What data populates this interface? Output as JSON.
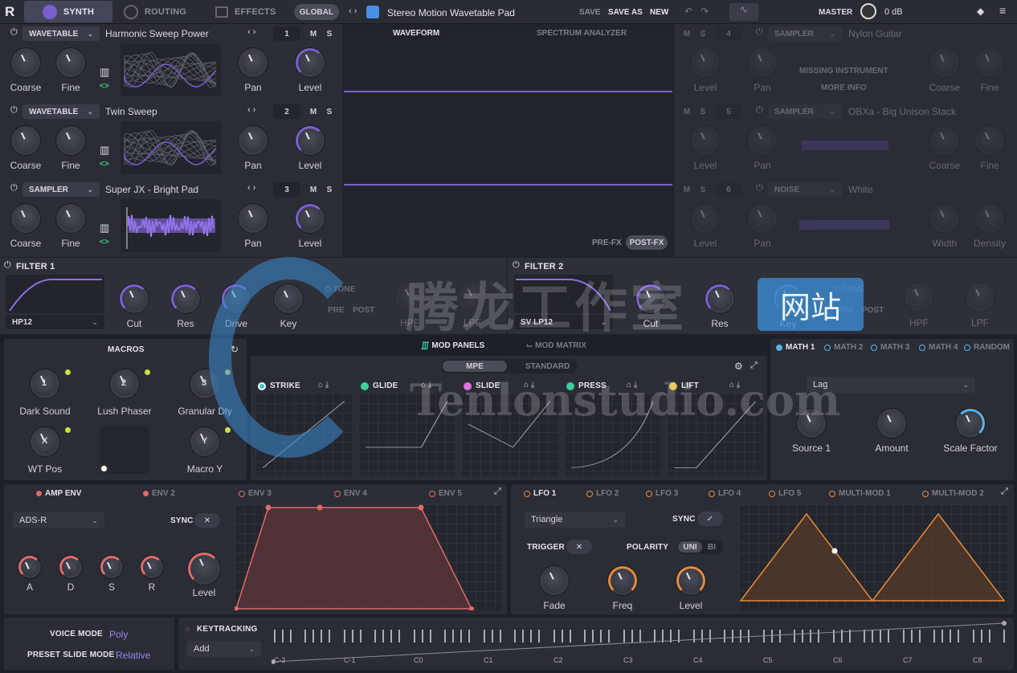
{
  "topbar": {
    "tabs": [
      {
        "label": "SYNTH"
      },
      {
        "label": "ROUTING"
      },
      {
        "label": "EFFECTS"
      }
    ],
    "global_label": "GLOBAL",
    "preset_name": "Stereo Motion Wavetable Pad",
    "save_label": "SAVE",
    "save_as_label": "SAVE AS",
    "new_label": "NEW",
    "master_label": "MASTER",
    "master_value": "0 dB"
  },
  "oscillators": [
    {
      "type": "WAVETABLE",
      "name": "Harmonic Sweep Power",
      "num": "1",
      "knobs": [
        "Coarse",
        "Fine",
        "Pan",
        "Level"
      ]
    },
    {
      "type": "WAVETABLE",
      "name": "Twin Sweep",
      "num": "2",
      "knobs": [
        "Coarse",
        "Fine",
        "Pan",
        "Level"
      ]
    },
    {
      "type": "SAMPLER",
      "name": "Super JX - Bright Pad",
      "num": "3",
      "knobs": [
        "Coarse",
        "Fine",
        "Pan",
        "Level"
      ]
    }
  ],
  "osc_m": "M",
  "osc_s": "S",
  "display": {
    "tab_waveform": "WAVEFORM",
    "tab_spectrum": "SPECTRUM ANALYZER",
    "pre_fx": "PRE-FX",
    "post_fx": "POST-FX"
  },
  "right_oscs": [
    {
      "num": "4",
      "type": "SAMPLER",
      "name": "Nylon Guitar",
      "missing": "MISSING INSTRUMENT",
      "more": "MORE INFO",
      "knobs": [
        "Level",
        "Pan",
        "Coarse",
        "Fine"
      ]
    },
    {
      "num": "5",
      "type": "SAMPLER",
      "name": "OBXa - Big Unison Stack",
      "knobs": [
        "Level",
        "Pan",
        "Coarse",
        "Fine"
      ]
    },
    {
      "num": "6",
      "type": "NOISE",
      "name": "White",
      "knobs": [
        "Level",
        "Pan",
        "Width",
        "Density"
      ]
    }
  ],
  "filter1": {
    "title": "FILTER 1",
    "type": "HP12",
    "knobs": [
      "Cut",
      "Res",
      "Drive",
      "Key"
    ],
    "tone": "TONE",
    "pre": "PRE",
    "post": "POST",
    "hpf": "HPF",
    "lpf": "LPF"
  },
  "filter2": {
    "title": "FILTER 2",
    "type": "SV LP12",
    "knobs": [
      "Cut",
      "Res",
      "Key"
    ],
    "tone": "TONE",
    "pre": "PRE",
    "post": "POST",
    "hpf": "HPF",
    "lpf": "LPF"
  },
  "macros": {
    "title": "MACROS",
    "items": [
      {
        "num": "1",
        "label": "Dark Sound"
      },
      {
        "num": "2",
        "label": "Lush Phaser"
      },
      {
        "num": "3",
        "label": "Granular Dly"
      },
      {
        "num": "X",
        "label": "WT Pos"
      },
      {
        "num": "Y",
        "label": "Macro Y"
      }
    ]
  },
  "mod": {
    "tab_panels": "MOD PANELS",
    "tab_matrix": "MOD MATRIX",
    "mpe": "MPE",
    "standard": "STANDARD",
    "panels": [
      {
        "label": "STRIKE",
        "color": "#35c0e0"
      },
      {
        "label": "GLIDE",
        "color": "#3ad0a0"
      },
      {
        "label": "SLIDE",
        "color": "#e070e0"
      },
      {
        "label": "PRESS",
        "color": "#3ad0a0"
      },
      {
        "label": "LIFT",
        "color": "#e8c040"
      }
    ]
  },
  "math": {
    "tabs": [
      "MATH 1",
      "MATH 2",
      "MATH 3",
      "MATH 4",
      "RANDOM"
    ],
    "mode": "Lag",
    "knobs": [
      "Source 1",
      "Amount",
      "Scale Factor"
    ]
  },
  "env": {
    "tabs": [
      "AMP ENV",
      "ENV 2",
      "ENV 3",
      "ENV 4",
      "ENV 5"
    ],
    "mode": "ADS-R",
    "sync": "SYNC",
    "knobs": [
      "A",
      "D",
      "S",
      "R"
    ],
    "level": "Level"
  },
  "lfo": {
    "tabs": [
      "LFO 1",
      "LFO 2",
      "LFO 3",
      "LFO 4",
      "LFO 5",
      "MULTI-MOD 1",
      "MULTI-MOD 2"
    ],
    "shape": "Triangle",
    "sync": "SYNC",
    "trigger": "TRIGGER",
    "polarity": "POLARITY",
    "uni": "UNI",
    "bi": "BI",
    "knobs": [
      "Fade",
      "Freq",
      "Level"
    ]
  },
  "voice": {
    "voice_mode_label": "VOICE MODE",
    "voice_mode_value": "Poly",
    "slide_label": "PRESET SLIDE MODE",
    "slide_value": "Relative"
  },
  "keytracking": {
    "title": "KEYTRACKING",
    "mode": "Add",
    "notes": [
      "C-2",
      "C-1",
      "C0",
      "C1",
      "C2",
      "C3",
      "C4",
      "C5",
      "C6",
      "C7",
      "C8"
    ]
  },
  "watermark": {
    "cn": "腾龙工作室",
    "site": "网站",
    "url": "Tenlonstudio.com"
  },
  "colors": {
    "accent": "#7a5fd0",
    "env": "#e06a6a",
    "lfo": "#e58a3a"
  }
}
